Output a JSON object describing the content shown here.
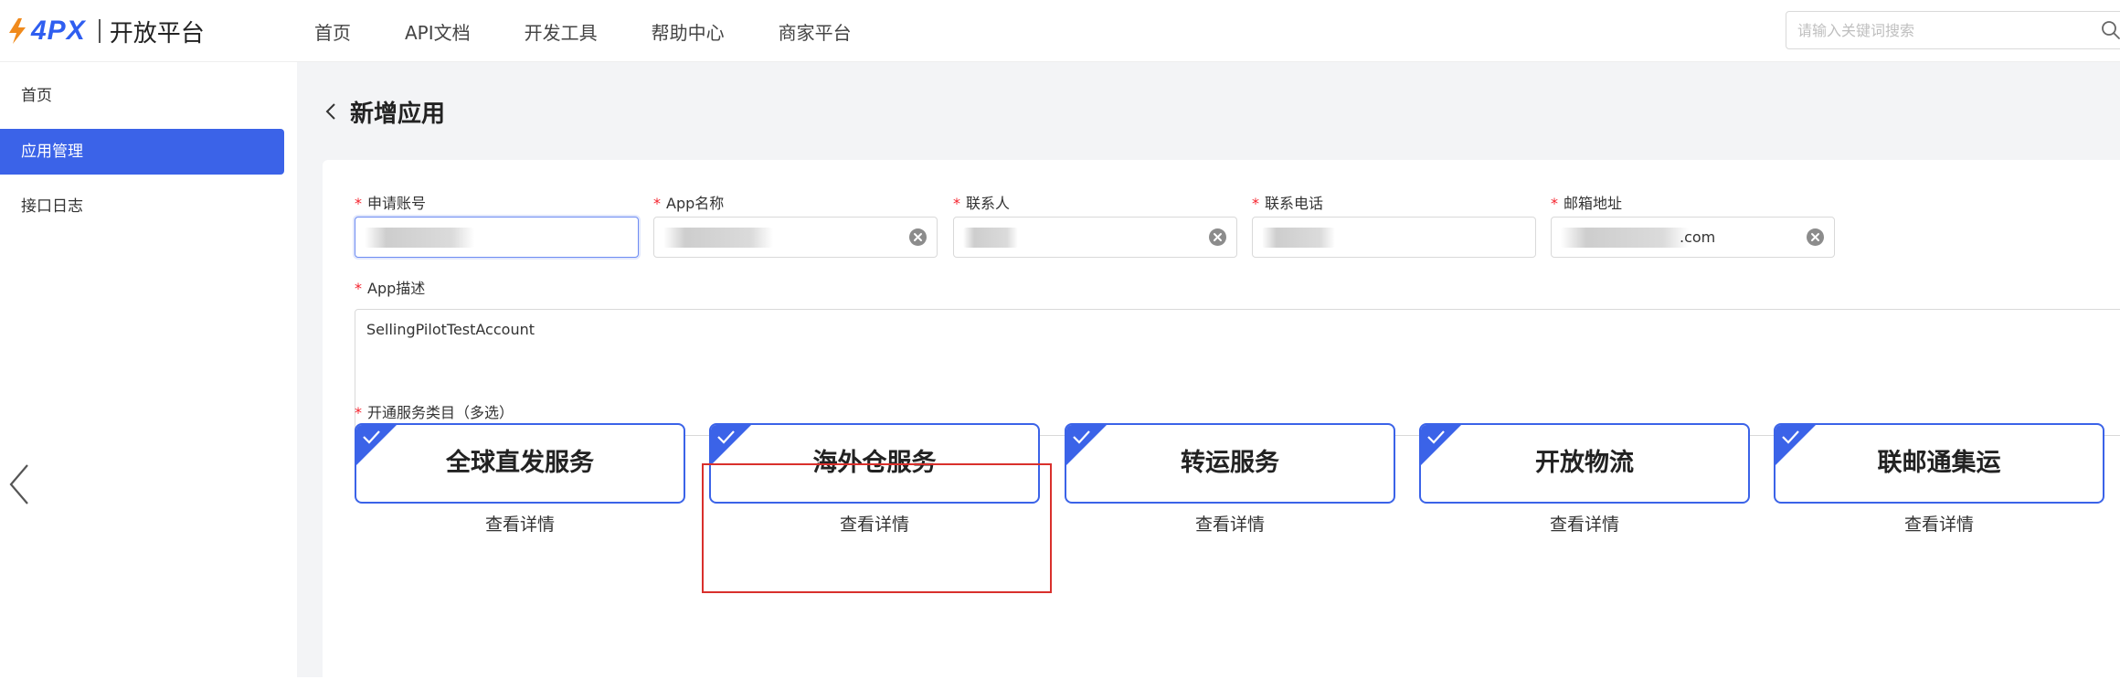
{
  "brand": {
    "logo": "4PX",
    "title": "开放平台",
    "accent": "#3b63e8",
    "logo_color": "#2f5ef0"
  },
  "topnav": {
    "items": [
      {
        "label": "首页"
      },
      {
        "label": "API文档"
      },
      {
        "label": "开发工具"
      },
      {
        "label": "帮助中心"
      },
      {
        "label": "商家平台"
      }
    ]
  },
  "search": {
    "placeholder": "请输入关键词搜索",
    "icon": "search-icon"
  },
  "sidebar": {
    "items": [
      {
        "label": "首页",
        "active": false
      },
      {
        "label": "应用管理",
        "active": true
      },
      {
        "label": "接口日志",
        "active": false
      }
    ]
  },
  "page": {
    "title": "新增应用"
  },
  "form": {
    "account": {
      "label": "申请账号"
    },
    "app_name": {
      "label": "App名称"
    },
    "contact": {
      "label": "联系人"
    },
    "phone": {
      "label": "联系电话"
    },
    "email": {
      "label": "邮箱地址",
      "value_visible": ".com"
    },
    "description": {
      "label": "App描述",
      "value": "SellingPilotTestAccount"
    },
    "services_label": "开通服务类目（多选）"
  },
  "services": [
    {
      "name": "全球直发服务",
      "link": "查看详情",
      "checked": true
    },
    {
      "name": "海外仓服务",
      "link": "查看详情",
      "checked": true
    },
    {
      "name": "转运服务",
      "link": "查看详情",
      "checked": true
    },
    {
      "name": "开放物流",
      "link": "查看详情",
      "checked": true
    },
    {
      "name": "联邮通集运",
      "link": "查看详情",
      "checked": true
    }
  ],
  "annotation": {
    "highlight_color": "#d9302c"
  }
}
